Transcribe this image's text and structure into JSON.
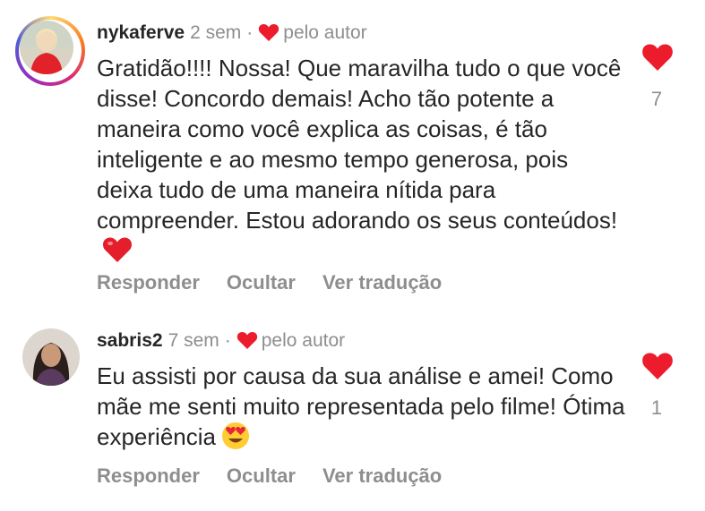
{
  "colors": {
    "heart": "#ed1c2c",
    "muted": "#8e8e8e",
    "text": "#262626"
  },
  "comments": [
    {
      "username": "nykaferve",
      "time": "2 sem",
      "separator": "·",
      "author_badge": "pelo autor",
      "text": "Gratidão!!!! Nossa! Que maravilha tudo o que você disse! Concordo demais! Acho tão potente a maneira como você explica as coisas, é tão inteligente e ao mesmo tempo generosa, pois deixa tudo de uma maneira nítida para compreender. Estou adorando os seus conteúdos!",
      "emoji": "red-heart-emoji",
      "actions": {
        "reply": "Responder",
        "hide": "Ocultar",
        "translate": "Ver tradução"
      },
      "like_count": "7"
    },
    {
      "username": "sabris2",
      "time": "7 sem",
      "separator": "·",
      "author_badge": "pelo autor",
      "text": "Eu assisti por causa da sua análise e amei! Como mãe me senti muito representada pelo filme! Ótima experiência",
      "emoji": "heart-eyes-emoji",
      "actions": {
        "reply": "Responder",
        "hide": "Ocultar",
        "translate": "Ver tradução"
      },
      "like_count": "1"
    }
  ]
}
